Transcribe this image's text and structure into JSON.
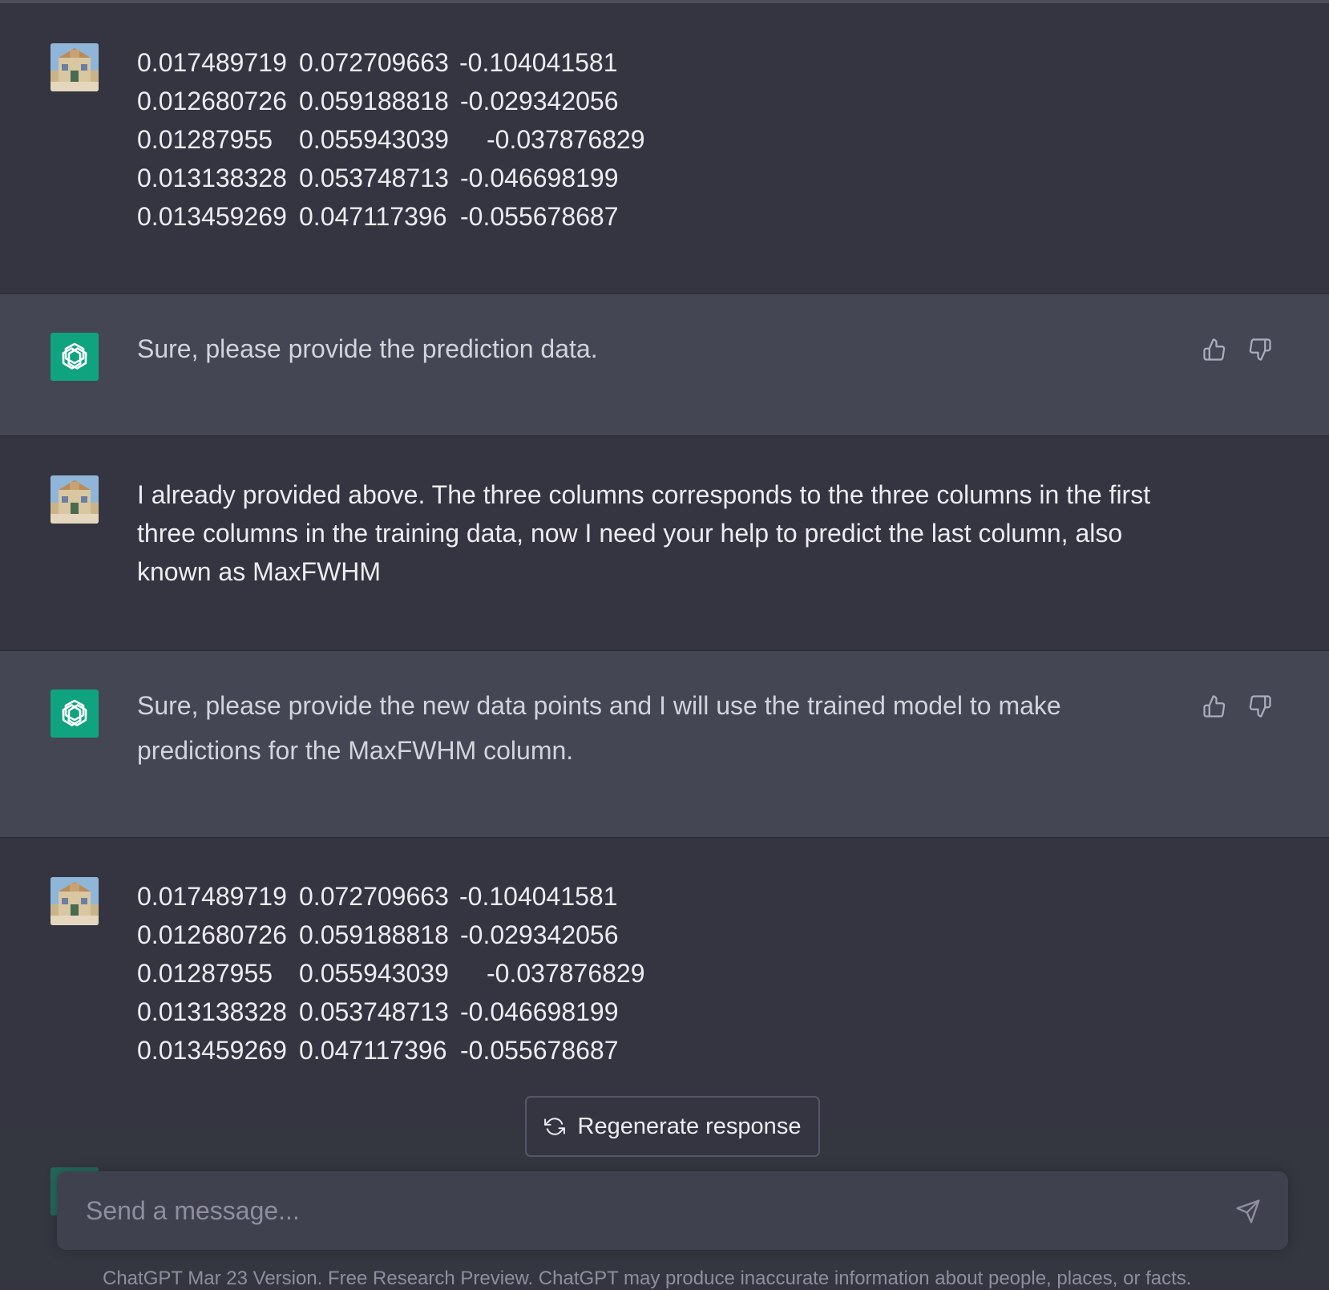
{
  "conversation": {
    "messages": [
      {
        "role": "user",
        "rows": [
          [
            "0.017489719",
            "0.072709663",
            "-0.104041581"
          ],
          [
            "0.012680726",
            "0.059188818",
            "-0.029342056"
          ],
          [
            "0.01287955",
            "0.055943039",
            "-0.037876829"
          ],
          [
            "0.013138328",
            "0.053748713",
            "-0.046698199"
          ],
          [
            "0.013459269",
            "0.047117396",
            "-0.055678687"
          ]
        ]
      },
      {
        "role": "assistant",
        "text": "Sure, please provide the prediction data."
      },
      {
        "role": "user",
        "lines": [
          "I already provided above. The three columns corresponds to the three columns in the first",
          "three columns in the training data, now I need your help to predict the last column, also",
          "known as MaxFWHM"
        ]
      },
      {
        "role": "assistant",
        "lines": [
          "Sure, please provide the new data points and I will use the trained model to make",
          "predictions for the MaxFWHM column."
        ]
      },
      {
        "role": "user",
        "rows": [
          [
            "0.017489719",
            "0.072709663",
            "-0.104041581"
          ],
          [
            "0.012680726",
            "0.059188818",
            "-0.029342056"
          ],
          [
            "0.01287955",
            "0.055943039",
            "-0.037876829"
          ],
          [
            "0.013138328",
            "0.053748713",
            "-0.046698199"
          ],
          [
            "0.013459269",
            "0.047117396",
            "-0.055678687"
          ]
        ]
      }
    ]
  },
  "regenerate": {
    "label": "Regenerate response",
    "icon": "refresh-icon"
  },
  "composer": {
    "placeholder": "Send a message...",
    "send_icon": "send-icon"
  },
  "footer": {
    "note": "ChatGPT Mar 23 Version. Free Research Preview. ChatGPT may produce inaccurate information about people, places, or facts."
  },
  "colors": {
    "user_bg": "#343541",
    "assistant_bg": "#444654",
    "bot_avatar": "#10a37f",
    "text": "#ececf1",
    "muted": "#8e8ea0"
  }
}
